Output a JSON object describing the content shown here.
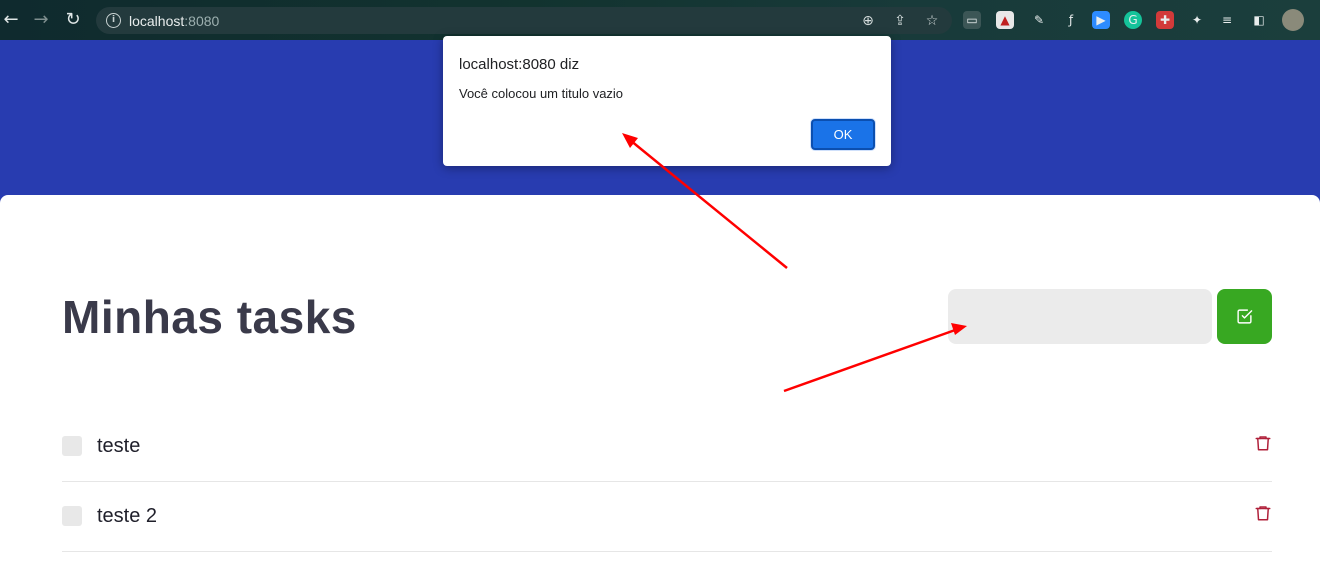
{
  "browser": {
    "url_host": "localhost",
    "url_port": ":8080",
    "icons": [
      "back-arrow-icon",
      "forward-arrow-icon",
      "reload-icon",
      "info-icon",
      "zoom-icon",
      "share-icon",
      "star-icon",
      "extension-icons",
      "puzzle-icon",
      "reading-list-icon",
      "sidebar-icon",
      "profile-avatar"
    ]
  },
  "page": {
    "title": "Minhas tasks",
    "input": {
      "value": "",
      "placeholder": ""
    },
    "add_button_icon": "check-square-icon",
    "tasks": [
      {
        "label": "teste",
        "checked": false
      },
      {
        "label": "teste 2",
        "checked": false
      }
    ],
    "colors": {
      "header": "#283cb0",
      "add_button": "#38a822",
      "trash": "#b0203a"
    }
  },
  "dialog": {
    "title": "localhost:8080 diz",
    "message": "Você colocou um titulo vazio",
    "ok_label": "OK"
  },
  "annotations": {
    "arrow_color": "#ff0000"
  }
}
